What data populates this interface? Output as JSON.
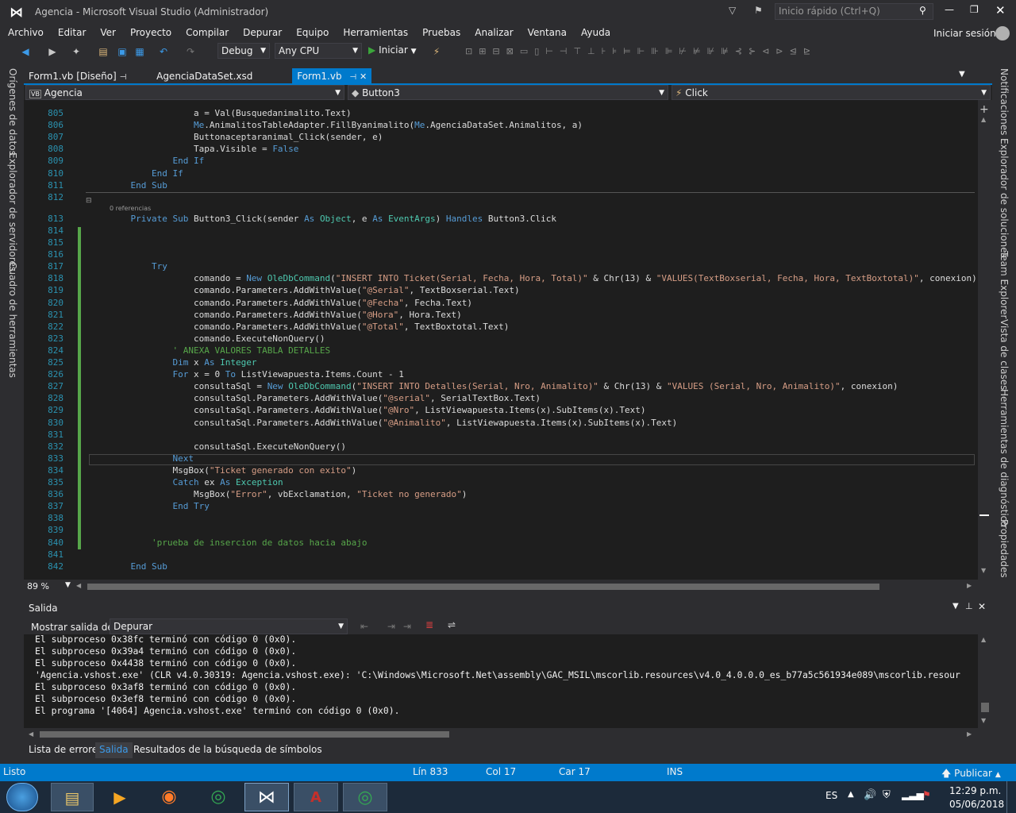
{
  "title": "Agencia - Microsoft Visual Studio (Administrador)",
  "quicklaunch_placeholder": "Inicio rápido (Ctrl+Q)",
  "signin": "Iniciar sesión",
  "menu": [
    "Archivo",
    "Editar",
    "Ver",
    "Proyecto",
    "Compilar",
    "Depurar",
    "Equipo",
    "Herramientas",
    "Pruebas",
    "Analizar",
    "Ventana",
    "Ayuda"
  ],
  "toolbar": {
    "config": "Debug",
    "platform": "Any CPU",
    "start": "Iniciar"
  },
  "tabs": [
    {
      "label": "Form1.vb [Diseño]"
    },
    {
      "label": "AgenciaDataSet.xsd"
    },
    {
      "label": "Form1.vb"
    }
  ],
  "nav": {
    "project": "Agencia",
    "object": "Button3",
    "event": "Click"
  },
  "left_panels": [
    "Orígenes de datos",
    "Explorador de servidores",
    "Cuadro de herramientas"
  ],
  "right_panels": [
    "Notificaciones",
    "Explorador de soluciones",
    "Team Explorer",
    "Vista de clases",
    "Herramientas de diagnóstico",
    "Propiedades"
  ],
  "zoom": "89 %",
  "refs": "0 referencias",
  "code_lines": [
    {
      "n": "805",
      "t": "                a = Val(Busquedanimalito.Text)"
    },
    {
      "n": "806",
      "t": "                Me.AnimalitosTableAdapter.FillByanimalito(Me.AgenciaDataSet.Animalitos, a)"
    },
    {
      "n": "807",
      "t": "                Buttonaceptaranimal_Click(sender, e)"
    },
    {
      "n": "808",
      "t": "                Tapa.Visible = False"
    },
    {
      "n": "809",
      "t": "            End If"
    },
    {
      "n": "810",
      "t": "        End If"
    },
    {
      "n": "811",
      "t": "    End Sub"
    },
    {
      "n": "812",
      "t": ""
    },
    {
      "n": "813",
      "t": "    Private Sub Button3_Click(sender As Object, e As EventArgs) Handles Button3.Click"
    },
    {
      "n": "814",
      "t": ""
    },
    {
      "n": "815",
      "t": ""
    },
    {
      "n": "816",
      "t": ""
    },
    {
      "n": "817",
      "t": "        Try"
    },
    {
      "n": "818",
      "t": "                comando = New OleDbCommand(\"INSERT INTO Ticket(Serial, Fecha, Hora, Total)\" & Chr(13) & \"VALUES(TextBoxserial, Fecha, Hora, TextBoxtotal)\", conexion)"
    },
    {
      "n": "819",
      "t": "                comando.Parameters.AddWithValue(\"@Serial\", TextBoxserial.Text)"
    },
    {
      "n": "820",
      "t": "                comando.Parameters.AddWithValue(\"@Fecha\", Fecha.Text)"
    },
    {
      "n": "821",
      "t": "                comando.Parameters.AddWithValue(\"@Hora\", Hora.Text)"
    },
    {
      "n": "822",
      "t": "                comando.Parameters.AddWithValue(\"@Total\", TextBoxtotal.Text)"
    },
    {
      "n": "823",
      "t": "                comando.ExecuteNonQuery()"
    },
    {
      "n": "824",
      "t": "            ' ANEXA VALORES TABLA DETALLES"
    },
    {
      "n": "825",
      "t": "            Dim x As Integer"
    },
    {
      "n": "826",
      "t": "            For x = 0 To ListViewapuesta.Items.Count - 1"
    },
    {
      "n": "827",
      "t": "                consultaSql = New OleDbCommand(\"INSERT INTO Detalles(Serial, Nro, Animalito)\" & Chr(13) & \"VALUES (Serial, Nro, Animalito)\", conexion)"
    },
    {
      "n": "828",
      "t": "                consultaSql.Parameters.AddWithValue(\"@serial\", SerialTextBox.Text)"
    },
    {
      "n": "829",
      "t": "                consultaSql.Parameters.AddWithValue(\"@Nro\", ListViewapuesta.Items(x).SubItems(x).Text)"
    },
    {
      "n": "830",
      "t": "                consultaSql.Parameters.AddWithValue(\"@Animalito\", ListViewapuesta.Items(x).SubItems(x).Text)"
    },
    {
      "n": "831",
      "t": ""
    },
    {
      "n": "832",
      "t": "                consultaSql.ExecuteNonQuery()"
    },
    {
      "n": "833",
      "t": "            Next"
    },
    {
      "n": "834",
      "t": "            MsgBox(\"Ticket generado con exito\")"
    },
    {
      "n": "835",
      "t": "            Catch ex As Exception"
    },
    {
      "n": "836",
      "t": "                MsgBox(\"Error\", vbExclamation, \"Ticket no generado\")"
    },
    {
      "n": "837",
      "t": "            End Try"
    },
    {
      "n": "838",
      "t": ""
    },
    {
      "n": "839",
      "t": ""
    },
    {
      "n": "840",
      "t": "        'prueba de insercion de datos hacia abajo"
    },
    {
      "n": "841",
      "t": ""
    },
    {
      "n": "842",
      "t": "    End Sub"
    }
  ],
  "output": {
    "title": "Salida",
    "show_label": "Mostrar salida de:",
    "source": "Depurar",
    "lines": [
      "El subproceso 0x38fc terminó con código 0 (0x0).",
      "El subproceso 0x39a4 terminó con código 0 (0x0).",
      "El subproceso 0x4438 terminó con código 0 (0x0).",
      "'Agencia.vshost.exe' (CLR v4.0.30319: Agencia.vshost.exe): 'C:\\Windows\\Microsoft.Net\\assembly\\GAC_MSIL\\mscorlib.resources\\v4.0_4.0.0.0_es_b77a5c561934e089\\mscorlib.resour",
      "El subproceso 0x3af8 terminó con código 0 (0x0).",
      "El subproceso 0x3ef8 terminó con código 0 (0x0).",
      "El programa '[4064] Agencia.vshost.exe' terminó con código 0 (0x0)."
    ]
  },
  "bottom_tabs": [
    "Lista de errores",
    "Salida",
    "Resultados de la búsqueda de símbolos"
  ],
  "status": {
    "ready": "Listo",
    "line": "Lín 833",
    "col": "Col 17",
    "car": "Car 17",
    "ins": "INS",
    "publish": "Publicar"
  },
  "taskbar": {
    "lang": "ES",
    "time": "12:29 p.m.",
    "date": "05/06/2018"
  },
  "colors": {
    "accent": "#007acc",
    "editor_bg": "#1e1e1e",
    "chrome": "#2d2d30"
  }
}
